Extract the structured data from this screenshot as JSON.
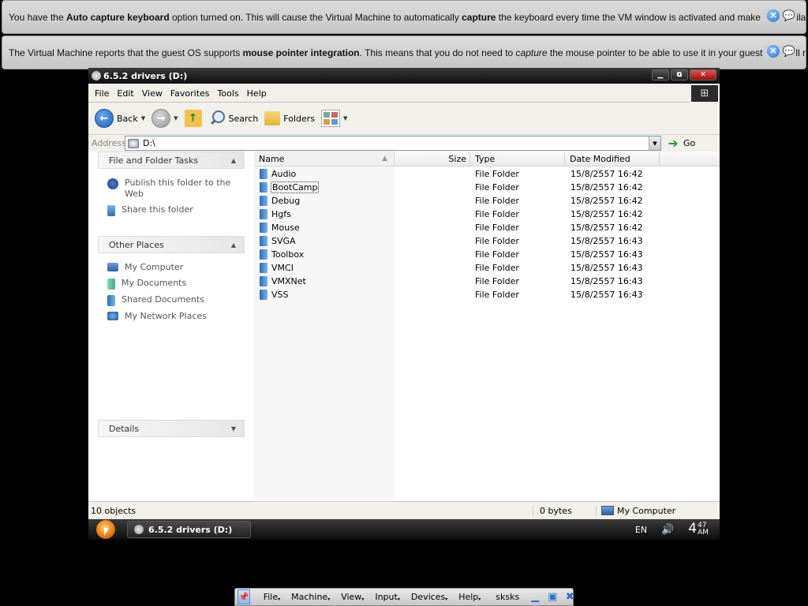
{
  "notifications": [
    {
      "segments": [
        {
          "text": "You have the ",
          "bold": false,
          "italic": false
        },
        {
          "text": "Auto capture keyboard",
          "bold": true,
          "italic": false
        },
        {
          "text": " option turned on. This will cause the Virtual Machine to automatically ",
          "bold": false,
          "italic": false
        },
        {
          "text": "capture",
          "bold": true,
          "italic": false
        },
        {
          "text": " the keyboard every time the VM window is activated and make it unavailable to",
          "bold": false,
          "italic": false
        }
      ]
    },
    {
      "segments": [
        {
          "text": "The Virtual Machine reports that the guest OS supports ",
          "bold": false,
          "italic": false
        },
        {
          "text": "mouse pointer integration",
          "bold": true,
          "italic": false
        },
        {
          "text": ". This means that you do not need to ",
          "bold": false,
          "italic": false
        },
        {
          "text": "capture",
          "bold": false,
          "italic": true
        },
        {
          "text": " the mouse pointer to be able to use it in your guest OS -- all mouse",
          "bold": false,
          "italic": false
        }
      ]
    }
  ],
  "window": {
    "title": "6.5.2 drivers (D:)",
    "buttons": {
      "minimize": "▁",
      "maximize": "⧉",
      "close": "✕"
    }
  },
  "menu": [
    "File",
    "Edit",
    "View",
    "Favorites",
    "Tools",
    "Help"
  ],
  "toolbar": {
    "back": "Back",
    "search": "Search",
    "folders": "Folders"
  },
  "address": {
    "label": "Address",
    "value": "D:\\",
    "go": "Go"
  },
  "tasks": {
    "file_folder": {
      "title": "File and Folder Tasks",
      "items": [
        {
          "label": "Publish this folder to the Web",
          "icon": "publish-web-icon"
        },
        {
          "label": "Share this folder",
          "icon": "share-folder-icon"
        }
      ]
    },
    "other_places": {
      "title": "Other Places",
      "items": [
        {
          "label": "My Computer",
          "icon": "my-computer-icon"
        },
        {
          "label": "My Documents",
          "icon": "my-documents-icon"
        },
        {
          "label": "Shared Documents",
          "icon": "shared-documents-icon"
        },
        {
          "label": "My Network Places",
          "icon": "network-places-icon"
        }
      ]
    },
    "details": {
      "title": "Details"
    }
  },
  "columns": {
    "name": "Name",
    "size": "Size",
    "type": "Type",
    "date": "Date Modified"
  },
  "files": [
    {
      "name": "Audio",
      "type": "File Folder",
      "date": "15/8/2557 16:42"
    },
    {
      "name": "BootCamp",
      "type": "File Folder",
      "date": "15/8/2557 16:42",
      "focused": true
    },
    {
      "name": "Debug",
      "type": "File Folder",
      "date": "15/8/2557 16:42"
    },
    {
      "name": "Hgfs",
      "type": "File Folder",
      "date": "15/8/2557 16:42"
    },
    {
      "name": "Mouse",
      "type": "File Folder",
      "date": "15/8/2557 16:42"
    },
    {
      "name": "SVGA",
      "type": "File Folder",
      "date": "15/8/2557 16:43"
    },
    {
      "name": "Toolbox",
      "type": "File Folder",
      "date": "15/8/2557 16:43"
    },
    {
      "name": "VMCI",
      "type": "File Folder",
      "date": "15/8/2557 16:43"
    },
    {
      "name": "VMXNet",
      "type": "File Folder",
      "date": "15/8/2557 16:43"
    },
    {
      "name": "VSS",
      "type": "File Folder",
      "date": "15/8/2557 16:43"
    }
  ],
  "status": {
    "objects": "10 objects",
    "size": "0 bytes",
    "location": "My Computer"
  },
  "taskbar": {
    "task": "6.5.2 drivers (D:)",
    "lang": "EN",
    "clock_hour": "4",
    "clock_min": "47",
    "clock_ampm": "AM"
  },
  "vbox_bar": {
    "menus": [
      "File",
      "Machine",
      "View",
      "Input",
      "Devices",
      "Help"
    ],
    "vm_name": "sksks"
  }
}
